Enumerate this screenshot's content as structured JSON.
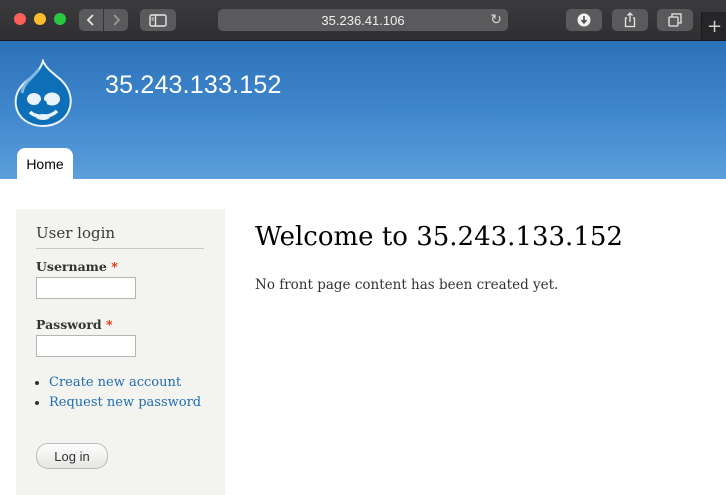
{
  "browser": {
    "url": "35.236.41.106",
    "icons": [
      "back-icon",
      "forward-icon",
      "sidebar-icon",
      "reload-icon",
      "download-icon",
      "share-icon",
      "tabs-icon",
      "plus-icon"
    ]
  },
  "site": {
    "name": "35.243.133.152",
    "nav": {
      "home_label": "Home"
    }
  },
  "sidebar": {
    "block_title": "User login",
    "username_label": "Username",
    "password_label": "Password",
    "required_marker": "*",
    "links": [
      "Create new account",
      "Request new password"
    ],
    "login_button": "Log in"
  },
  "main": {
    "title": "Welcome to 35.243.133.152",
    "body": "No front page content has been created yet."
  },
  "colors": {
    "header_top": "#2c72b9",
    "header_bottom": "#5ba0db",
    "link": "#1f6cb0",
    "required": "#e32700"
  }
}
